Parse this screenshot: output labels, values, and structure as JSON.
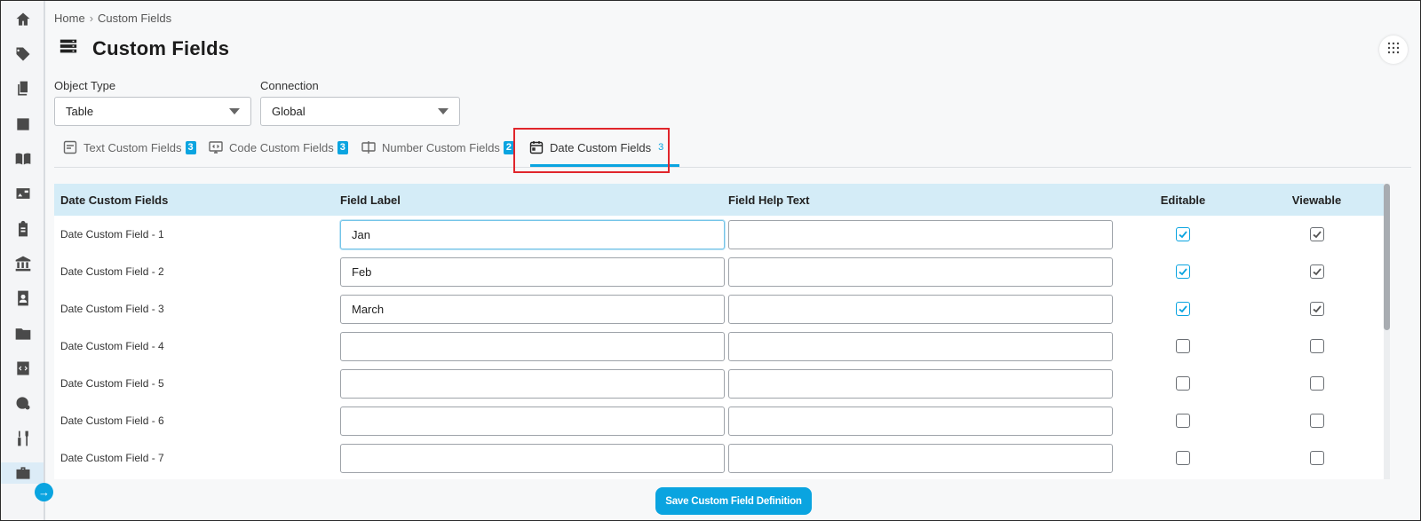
{
  "breadcrumb": {
    "home": "Home",
    "separator": "›",
    "current": "Custom Fields"
  },
  "page": {
    "title": "Custom Fields",
    "title_icon": "server-stack-icon",
    "menu_icon": "grid-dots-icon"
  },
  "filters": {
    "object_type": {
      "label": "Object Type",
      "value": "Table"
    },
    "connection": {
      "label": "Connection",
      "value": "Global"
    }
  },
  "tabs": [
    {
      "label": "Text Custom Fields",
      "count": "3",
      "icon": "text-field-icon",
      "active": false
    },
    {
      "label": "Code Custom Fields",
      "count": "3",
      "icon": "code-monitor-icon",
      "active": false
    },
    {
      "label": "Number Custom Fields",
      "count": "2",
      "icon": "number-field-icon",
      "active": false
    },
    {
      "label": "Date Custom Fields",
      "count": "3",
      "icon": "calendar-icon",
      "active": true
    }
  ],
  "table": {
    "headers": [
      "Date Custom Fields",
      "Field Label",
      "Field Help Text",
      "Editable",
      "Viewable"
    ],
    "rows": [
      {
        "name": "Date Custom Field - 1",
        "label": "Jan",
        "help": "",
        "editable": true,
        "viewable": true
      },
      {
        "name": "Date Custom Field - 2",
        "label": "Feb",
        "help": "",
        "editable": true,
        "viewable": true
      },
      {
        "name": "Date Custom Field - 3",
        "label": "March",
        "help": "",
        "editable": true,
        "viewable": true
      },
      {
        "name": "Date Custom Field - 4",
        "label": "",
        "help": "",
        "editable": false,
        "viewable": false
      },
      {
        "name": "Date Custom Field - 5",
        "label": "",
        "help": "",
        "editable": false,
        "viewable": false
      },
      {
        "name": "Date Custom Field - 6",
        "label": "",
        "help": "",
        "editable": false,
        "viewable": false
      },
      {
        "name": "Date Custom Field - 7",
        "label": "",
        "help": "",
        "editable": false,
        "viewable": false
      }
    ]
  },
  "actions": {
    "save_label": "Save Custom Field Definition"
  },
  "colors": {
    "accent": "#0aa4e0",
    "header_bg": "#d4ecf7",
    "highlight": "#e0252b"
  },
  "rail_icons": [
    "home-icon",
    "tag-icon",
    "documents-icon",
    "archive-icon",
    "book-icon",
    "image-card-icon",
    "clipboard-icon",
    "bank-icon",
    "contact-book-icon",
    "folder-icon",
    "code-file-icon",
    "timer-settings-icon",
    "tools-icon",
    "briefcase-icon"
  ]
}
